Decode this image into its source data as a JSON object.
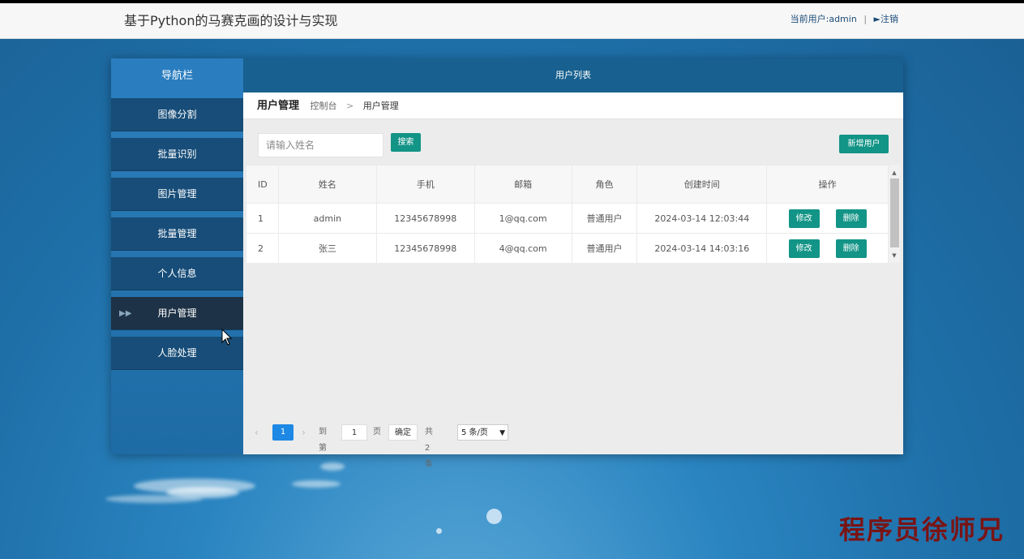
{
  "header": {
    "site_title": "基于Python的马赛克画的设计与实现",
    "current_user": "当前用户:admin",
    "separator": "|",
    "logout_label": "►注销"
  },
  "sidebar": {
    "title": "导航栏",
    "items": [
      {
        "label": "图像分割",
        "active": false
      },
      {
        "label": "批量识别",
        "active": false
      },
      {
        "label": "图片管理",
        "active": false
      },
      {
        "label": "批量管理",
        "active": false
      },
      {
        "label": "个人信息",
        "active": false
      },
      {
        "label": "用户管理",
        "active": true
      },
      {
        "label": "人脸处理",
        "active": false
      }
    ]
  },
  "main": {
    "list_title": "用户列表",
    "breadcrumb": {
      "title": "用户管理",
      "console": "控制台",
      "separator": ">",
      "current": "用户管理"
    },
    "search": {
      "placeholder": "请输入姓名",
      "value": "",
      "button_label": "搜索"
    },
    "add_button_label": "新增用户",
    "table": {
      "columns": [
        "ID",
        "姓名",
        "手机",
        "邮箱",
        "角色",
        "创建时间",
        "操作"
      ],
      "rows": [
        [
          "1",
          "admin",
          "12345678998",
          "1@qq.com",
          "普通用户",
          "2024-03-14 12:03:44"
        ],
        [
          "2",
          "张三",
          "12345678998",
          "4@qq.com",
          "普通用户",
          "2024-03-14 14:03:16"
        ]
      ],
      "edit_label": "修改",
      "delete_label": "删除"
    },
    "pagination": {
      "prev": "‹",
      "current_page": "1",
      "next": "›",
      "goto_label": "到第",
      "goto_value": "1",
      "page_unit": "页",
      "confirm_label": "确定",
      "total_label": "共 2 条",
      "page_size": "5 条/页"
    }
  },
  "watermark": "程序员徐师兄",
  "colors": {
    "accent": "#129486",
    "nav_bg": "#174d78",
    "nav_active": "#1d3246",
    "header_bar": "#17608f",
    "page_active": "#1e88e5"
  }
}
